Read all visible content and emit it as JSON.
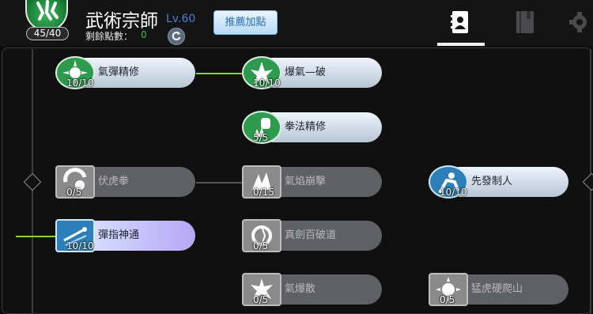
{
  "header": {
    "title": "武術宗師",
    "level_text": "Lv.60",
    "class_level": "45/40",
    "points_label": "剩餘點數：",
    "points_value": "0",
    "recommend_label": "推薦加點",
    "tabs": [
      "skills-card",
      "book",
      "gear"
    ]
  },
  "skills": [
    {
      "name": "氣彈精修",
      "count": "10/10",
      "state": "learned"
    },
    {
      "name": "爆氣—破",
      "count": "10/10",
      "state": "learned"
    },
    {
      "name": "拳法精修",
      "count": "5/5",
      "state": "learned"
    },
    {
      "name": "伏虎拳",
      "count": "0/5",
      "state": "locked"
    },
    {
      "name": "氣焰崩擊",
      "count": "0/15",
      "state": "locked"
    },
    {
      "name": "先發制人",
      "count": "10/10",
      "state": "learned"
    },
    {
      "name": "彈指神通",
      "count": "10/10",
      "state": "special"
    },
    {
      "name": "真劍百破道",
      "count": "0/5",
      "state": "locked"
    },
    {
      "name": "氣爆散",
      "count": "0/5",
      "state": "locked"
    },
    {
      "name": "猛虎硬爬山",
      "count": "0/5",
      "state": "locked"
    }
  ],
  "colors": {
    "learned_icon": "#2e9a4e",
    "special_icon": "#2c7fb8",
    "locked_icon": "#7a7a7a",
    "connector_active": "#8bd32a",
    "connector_inactive": "#555555"
  }
}
